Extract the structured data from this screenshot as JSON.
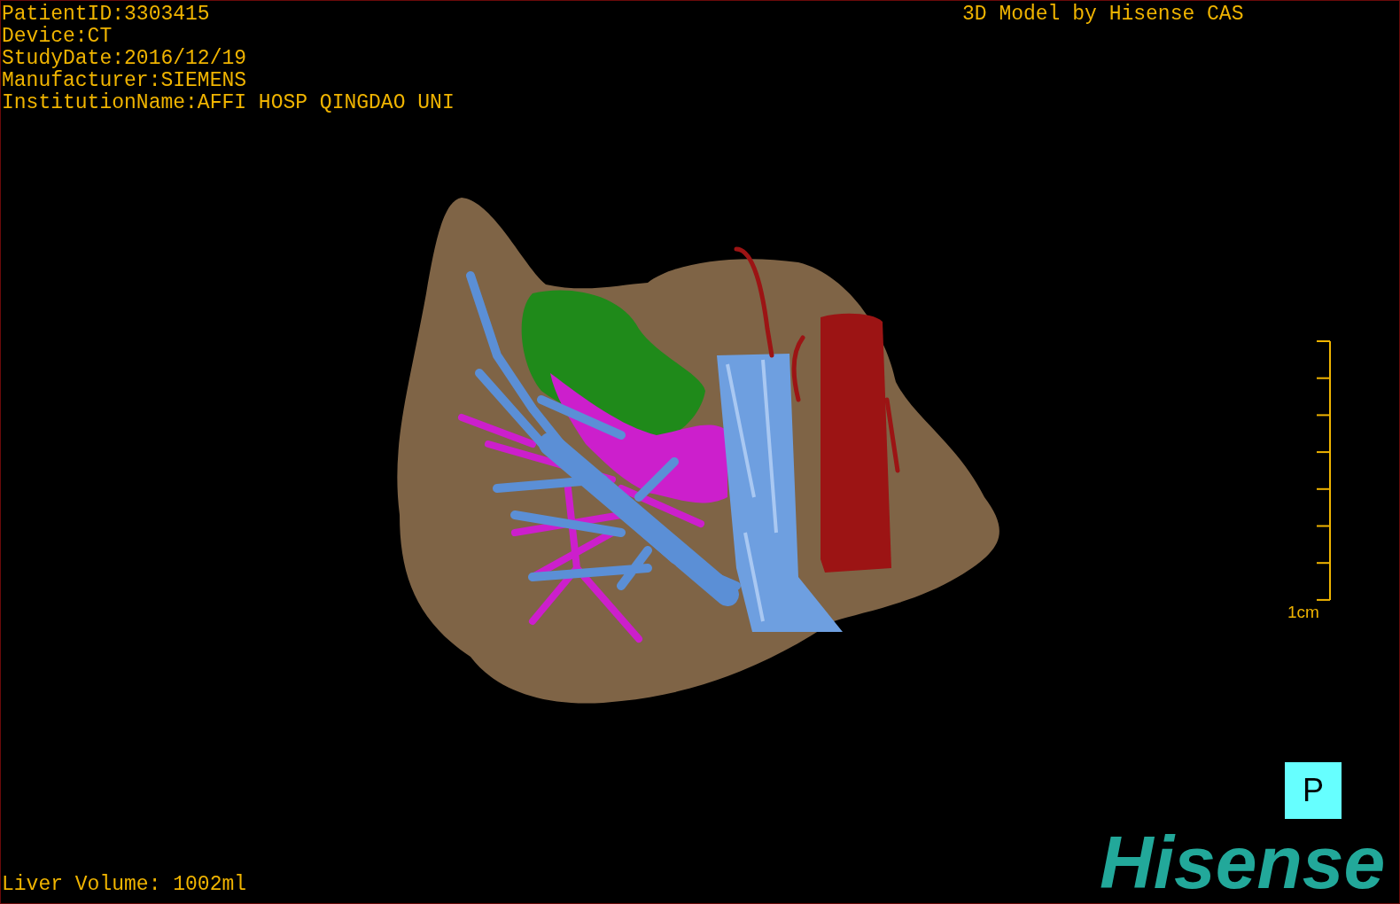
{
  "patient_info": [
    "PatientID:3303415",
    "Device:CT",
    "StudyDate:2016/12/19",
    "Manufacturer:SIEMENS",
    "InstitutionName:AFFI HOSP QINGDAO UNI"
  ],
  "model_credit": "3D Model by Hisense CAS",
  "scale_bar": {
    "label": "1cm"
  },
  "orientation_marker": "P",
  "liver_volume": "Liver Volume: 1002ml",
  "logo": "Hisense"
}
